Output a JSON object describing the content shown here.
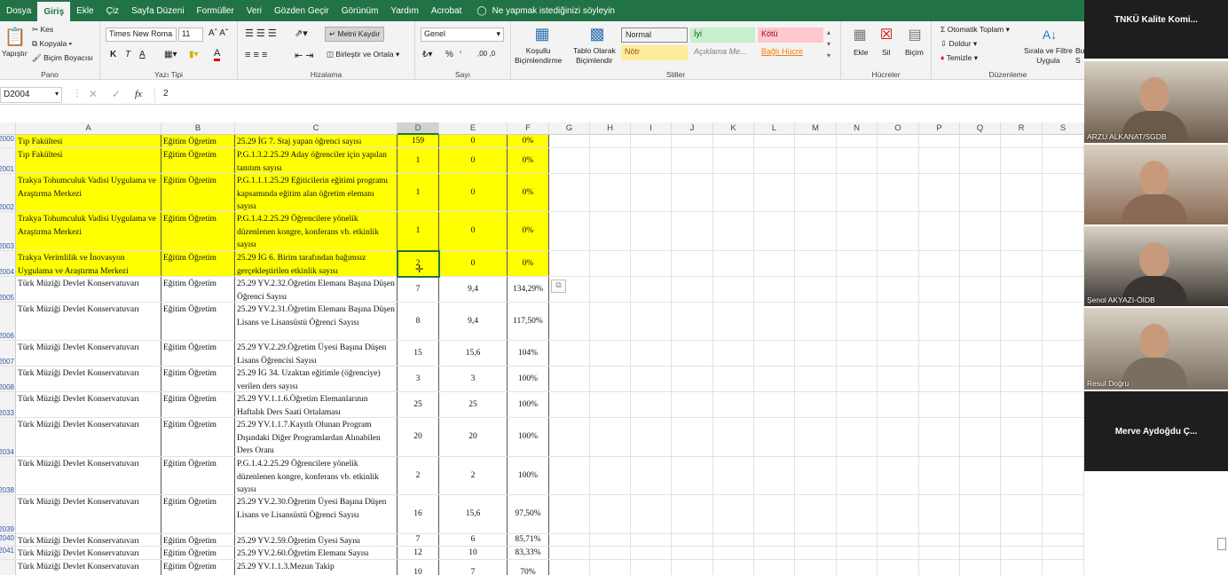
{
  "menu": {
    "tabs": [
      "Dosya",
      "Giriş",
      "Ekle",
      "Çiz",
      "Sayfa Düzeni",
      "Formüller",
      "Veri",
      "Gözden Geçir",
      "Görünüm",
      "Yardım",
      "Acrobat"
    ],
    "active": "Giriş",
    "tell_me": "Ne yapmak istediğinizi söyleyin"
  },
  "ribbon": {
    "paste": "Yapıştır",
    "cut": "Kes",
    "copy": "Kopyala",
    "format_painter": "Biçim Boyacısı",
    "group_clipboard": "Pano",
    "font_name": "Times New Roma",
    "font_size": "11",
    "bold": "K",
    "italic": "T",
    "underline": "A",
    "font_color": "A",
    "group_font": "Yazı Tipi",
    "wrap_text": "Metni Kaydır",
    "merge_center": "Birleştir ve Ortala",
    "group_alignment": "Hizalama",
    "number_format": "Genel",
    "percent": "%",
    "comma": "000",
    "group_number": "Sayı",
    "conditional": "Koşullu\nBiçimlendirme",
    "format_table": "Tablo Olarak\nBiçimlendir",
    "styles": [
      {
        "label": "Normal",
        "bg": "#ffffff",
        "fg": "#000000"
      },
      {
        "label": "İyi",
        "bg": "#c6efce",
        "fg": "#006100"
      },
      {
        "label": "Kötü",
        "bg": "#ffc7ce",
        "fg": "#9c0006"
      },
      {
        "label": "Nötr",
        "bg": "#ffeb9c",
        "fg": "#9c5700"
      },
      {
        "label": "Açıklama Me...",
        "bg": "#f3f3f3",
        "fg": "#7f7f7f"
      },
      {
        "label": "Bağlı Hücre",
        "bg": "#f3f3f3",
        "fg": "#fa7d00"
      }
    ],
    "group_styles": "Stiller",
    "insert": "Ekle",
    "delete": "Sil",
    "format": "Biçim",
    "group_cells": "Hücreler",
    "autosum": "Otomatik Toplam",
    "fill": "Doldur",
    "clear": "Temizle",
    "sort_filter": "Sırala ve Filtre\nUygula",
    "find": "Bu\nS",
    "group_editing": "Düzenleme"
  },
  "formula_bar": {
    "name_box": "D2004",
    "content": "2",
    "fx": "fx"
  },
  "columns": [
    "A",
    "B",
    "C",
    "D",
    "E",
    "F",
    "G",
    "H",
    "I",
    "J",
    "K",
    "L",
    "M",
    "N",
    "O",
    "P",
    "Q",
    "R",
    "S"
  ],
  "selected_column": "D",
  "rows": [
    {
      "num": "2000",
      "h": 15,
      "y": true,
      "a": "Tıp Fakültesi",
      "b": "Eğitim Öğretim",
      "c": "25.29 İG 7. Staj yapan öğrenci sayısı",
      "d": "159",
      "e": "0",
      "f": "0%"
    },
    {
      "num": "2001",
      "h": 29,
      "y": true,
      "a": "Tıp Fakültesi",
      "b": "Eğitim Öğretim",
      "c": "P.G.1.3.2.25.29 Aday öğrenciler için yapılan tanıtım sayısı",
      "d": "1",
      "e": "0",
      "f": "0%"
    },
    {
      "num": "2002",
      "h": 43,
      "y": true,
      "a": "Trakya Tohumculuk Vadisi Uygulama ve Araştırma Merkezi",
      "b": "Eğitim Öğretim",
      "c": "P.G.1.1.1.25.29 Eğiticilerin eğitimi programı kapsamında eğitim alan öğretim elemanı sayısı",
      "d": "1",
      "e": "0",
      "f": "0%"
    },
    {
      "num": "2003",
      "h": 44,
      "y": true,
      "a": "Trakya Tohumculuk Vadisi Uygulama ve Araştırma Merkezi",
      "b": "Eğitim Öğretim",
      "c": "P.G.1.4.2.25.29 Öğrencilere yönelik düzenlenen kongre, konferans vb. etkinlik sayısı",
      "d": "1",
      "e": "0",
      "f": "0%"
    },
    {
      "num": "2004",
      "h": 29,
      "y": true,
      "a": "Trakya Verimlilik ve İnovasyon Uygulama ve Araştırma Merkezi",
      "b": "Eğitim Öğretim",
      "c": "25.29 İG 6. Birim tarafından bağımsız gerçekleştirilen etkinlik sayısı",
      "d": "2",
      "e": "0",
      "f": "0%"
    },
    {
      "num": "2005",
      "h": 29,
      "y": false,
      "a": "Türk Müziği Devlet Konservatuvarı",
      "b": "Eğitim Öğretim",
      "c": "25.29 YV.2.32.Öğretim Elemanı Başına Düşen Öğrenci Sayısı",
      "d": "7",
      "e": "9,4",
      "f": "134,29%"
    },
    {
      "num": "2006",
      "h": 43,
      "y": false,
      "a": "Türk Müziği Devlet Konservatuvarı",
      "b": "Eğitim Öğretim",
      "c": "25.29 YV.2.31.Öğretim Elemanı Başına Düşen Lisans ve Lisansüstü Öğrenci Sayısı",
      "d": "8",
      "e": "9,4",
      "f": "117,50%"
    },
    {
      "num": "2007",
      "h": 29,
      "y": false,
      "a": "Türk Müziği Devlet Konservatuvarı",
      "b": "Eğitim Öğretim",
      "c": "25.29 YV.2.29.Öğretim Üyesi Başına Düşen Lisans Öğrencisi Sayısı",
      "d": "15",
      "e": "15,6",
      "f": "104%"
    },
    {
      "num": "2008",
      "h": 29,
      "y": false,
      "a": "Türk Müziği Devlet Konservatuvarı",
      "b": "Eğitim Öğretim",
      "c": "25.29 İG 34. Uzaktan eğitimle (öğrenciye) verilen ders sayısı",
      "d": "3",
      "e": "3",
      "f": "100%"
    },
    {
      "num": "2033",
      "h": 29,
      "y": false,
      "a": "Türk Müziği Devlet Konservatuvarı",
      "b": "Eğitim Öğretim",
      "c": "25.29 YV.1.1.6.Öğretim Elemanlarının Haftalık Ders Saati Ortalaması",
      "d": "25",
      "e": "25",
      "f": "100%"
    },
    {
      "num": "2034",
      "h": 44,
      "y": false,
      "a": "Türk Müziği Devlet Konservatuvarı",
      "b": "Eğitim Öğretim",
      "c": "25.29 YV.1.1.7.Kayıtlı Olunan Program Dışındaki Diğer Programlardan Alınabilen Ders Oranı",
      "d": "20",
      "e": "20",
      "f": "100%"
    },
    {
      "num": "2038",
      "h": 43,
      "y": false,
      "a": "Türk Müziği Devlet Konservatuvarı",
      "b": "Eğitim Öğretim",
      "c": "P.G.1.4.2.25.29 Öğrencilere yönelik düzenlenen kongre, konferans vb. etkinlik sayısı",
      "d": "2",
      "e": "2",
      "f": "100%"
    },
    {
      "num": "2039",
      "h": 44,
      "y": false,
      "a": "Türk Müziği Devlet Konservatuvarı",
      "b": "Eğitim Öğretim",
      "c": "25.29 YV.2.30.Öğretim Üyesi Başına Düşen Lisans ve Lisansüstü Öğrenci Sayısı",
      "d": "16",
      "e": "15,6",
      "f": "97,50%"
    },
    {
      "num": "2040",
      "h": 14,
      "y": false,
      "a": "Türk Müziği Devlet Konservatuvarı",
      "b": "Eğitim Öğretim",
      "c": "25.29 YV.2.59.Öğretim Üyesi Sayısı",
      "d": "7",
      "e": "6",
      "f": "85,71%"
    },
    {
      "num": "2041",
      "h": 15,
      "y": false,
      "a": "Türk Müziği Devlet Konservatuvarı",
      "b": "Eğitim Öğretim",
      "c": "25.29 YV.2.60.Öğretim Elemanı Sayısı",
      "d": "12",
      "e": "10",
      "f": "83,33%"
    },
    {
      "num": "",
      "h": 30,
      "y": false,
      "a": "Türk Müziği Devlet Konservatuvarı",
      "b": "Eğitim Öğretim",
      "c": "25.29 YV.1.1.3.Mezun Takip",
      "d": "10",
      "e": "7",
      "f": "70%"
    }
  ],
  "video": {
    "top_label": "TNKÜ Kalite Komi...",
    "participants": [
      {
        "name": "ARZU ALKANAT/SGDB",
        "color": "#6b5a4a"
      },
      {
        "name": "",
        "color": "#8a6a55"
      },
      {
        "name": "Şenol AKYAZI-ÖİDB",
        "color": "#3a3530"
      },
      {
        "name": "Resul Doğru",
        "color": "#7a6e60"
      }
    ],
    "bottom_label": "Merve Aydoğdu Ç..."
  }
}
